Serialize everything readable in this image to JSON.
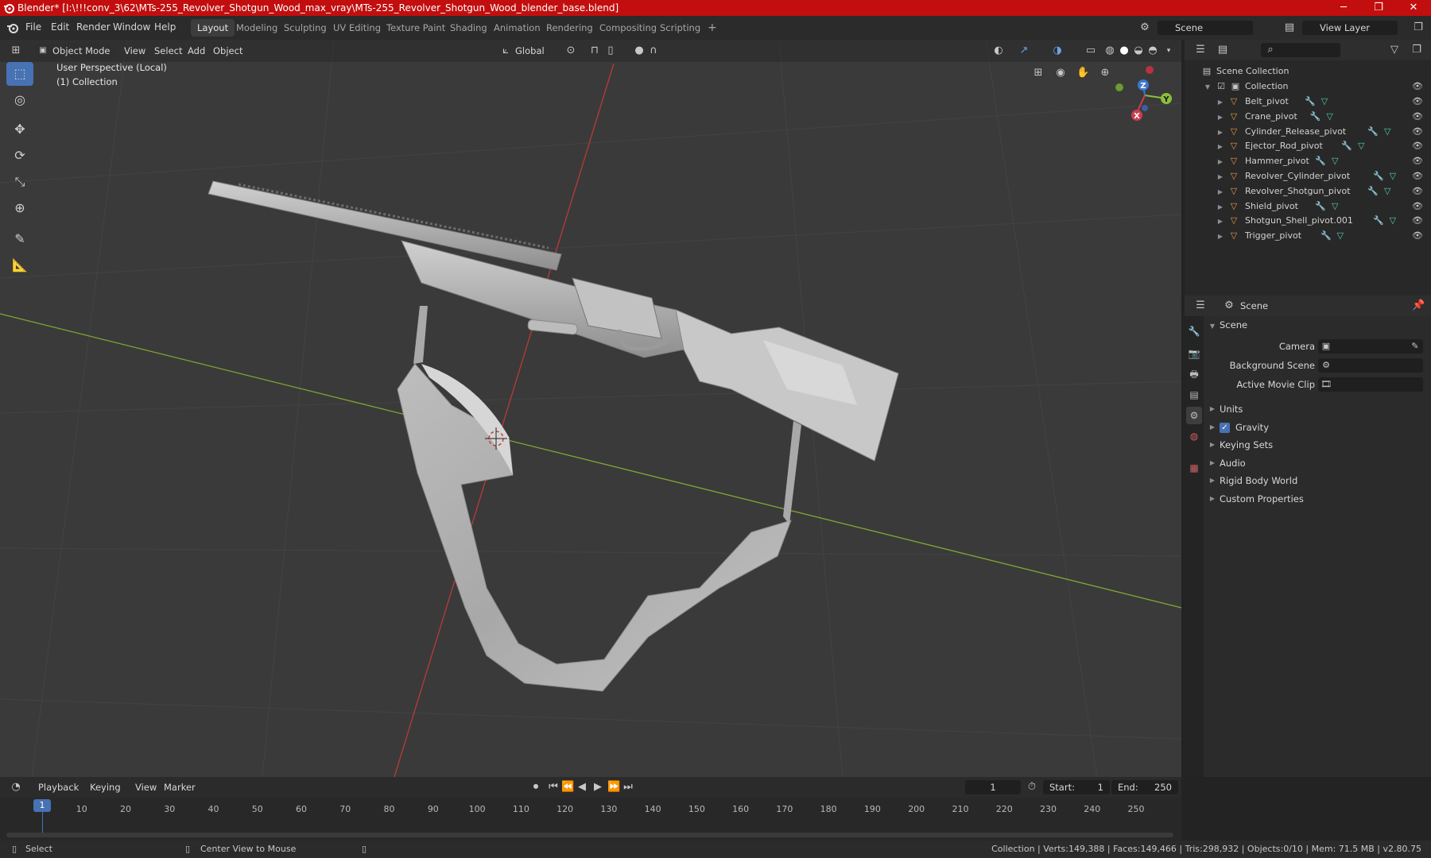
{
  "window": {
    "title": "Blender* [I:\\!!!conv_3\\62\\MTs-255_Revolver_Shotgun_Wood_max_vray\\MTs-255_Revolver_Shotgun_Wood_blender_base.blend]",
    "minimize": "─",
    "maximize": "❐",
    "close": "✕"
  },
  "menu": [
    "File",
    "Edit",
    "Render",
    "Window",
    "Help"
  ],
  "workspaces": [
    "Layout",
    "Modeling",
    "Sculpting",
    "UV Editing",
    "Texture Paint",
    "Shading",
    "Animation",
    "Rendering",
    "Compositing",
    "Scripting"
  ],
  "add_workspace": "+",
  "scene_field": "Scene",
  "view_layer_field": "View Layer",
  "viewport": {
    "mode": "Object Mode",
    "menus": [
      "View",
      "Select",
      "Add",
      "Object"
    ],
    "orientation": "Global",
    "perspective": "User Perspective (Local)",
    "collection": "(1) Collection",
    "gizmo": {
      "x": "X",
      "y": "Y",
      "z": "Z"
    }
  },
  "outliner": {
    "root": "Scene Collection",
    "collection": "Collection",
    "items": [
      "Belt_pivot",
      "Crane_pivot",
      "Cylinder_Release_pivot",
      "Ejector_Rod_pivot",
      "Hammer_pivot",
      "Revolver_Cylinder_pivot",
      "Revolver_Shotgun_pivot",
      "Shield_pivot",
      "Shotgun_Shell_pivot.001",
      "Trigger_pivot"
    ]
  },
  "properties": {
    "header": "Scene",
    "panel": "Scene",
    "fields": [
      {
        "label": "Camera"
      },
      {
        "label": "Background Scene"
      },
      {
        "label": "Active Movie Clip"
      }
    ],
    "sections": [
      "Units",
      "Gravity",
      "Keying Sets",
      "Audio",
      "Rigid Body World",
      "Custom Properties"
    ],
    "gravity_checked": true
  },
  "timeline": {
    "menus": [
      "Playback",
      "Keying",
      "View",
      "Marker"
    ],
    "current_frame": "1",
    "start_label": "Start:",
    "start": "1",
    "end_label": "End:",
    "end": "250",
    "ticks": [
      "10",
      "20",
      "30",
      "40",
      "50",
      "60",
      "70",
      "80",
      "90",
      "100",
      "110",
      "120",
      "130",
      "140",
      "150",
      "160",
      "170",
      "180",
      "190",
      "200",
      "210",
      "220",
      "230",
      "240",
      "250"
    ]
  },
  "status": {
    "select": "Select",
    "center_view": "Center View to Mouse",
    "stats": "Collection | Verts:149,388 | Faces:149,466 | Tris:298,932 | Objects:0/10 | Mem: 71.5 MB | v2.80.75"
  }
}
